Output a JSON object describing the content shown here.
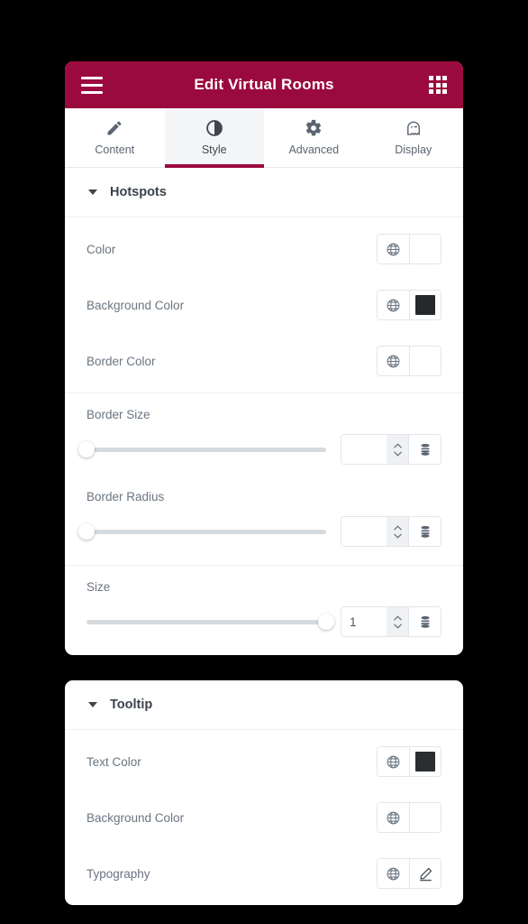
{
  "titlebar": {
    "menu_icon": "hamburger-icon",
    "title": "Edit Virtual Rooms",
    "apps_icon": "grid-apps-icon",
    "background_color": "#9B0A3E",
    "text_color": "#FFFFFF"
  },
  "tabs": [
    {
      "label": "Content",
      "icon": "pencil-icon",
      "active": false
    },
    {
      "label": "Style",
      "icon": "contrast-icon",
      "active": true
    },
    {
      "label": "Advanced",
      "icon": "gear-icon",
      "active": false
    },
    {
      "label": "Display",
      "icon": "ghost-icon",
      "active": false
    }
  ],
  "sections": [
    {
      "title": "Hotspots",
      "expanded": true,
      "groups": [
        {
          "controls": [
            {
              "type": "color",
              "label": "Color",
              "globe_icon": "globe-icon",
              "swatch": "none"
            },
            {
              "type": "color",
              "label": "Background Color",
              "globe_icon": "globe-icon",
              "swatch": "#26292C"
            },
            {
              "type": "color",
              "label": "Border Color",
              "globe_icon": "globe-icon",
              "swatch": "none"
            }
          ]
        },
        {
          "controls": [
            {
              "type": "slider",
              "label": "Border Size",
              "value": "",
              "placeholder": "",
              "handle_percent": 0,
              "spin_icon": "up-down-chevrons-icon",
              "units_icon": "units-stack-icon"
            },
            {
              "type": "slider",
              "label": "Border Radius",
              "value": "",
              "placeholder": "",
              "handle_percent": 0,
              "spin_icon": "up-down-chevrons-icon",
              "units_icon": "units-stack-icon"
            }
          ]
        },
        {
          "controls": [
            {
              "type": "slider",
              "label": "Size",
              "value": "1",
              "placeholder": "",
              "handle_percent": 100,
              "spin_icon": "up-down-chevrons-icon",
              "units_icon": "units-stack-icon"
            }
          ]
        }
      ]
    },
    {
      "title": "Tooltip",
      "expanded": true,
      "groups": [
        {
          "controls": [
            {
              "type": "color",
              "label": "Text Color",
              "globe_icon": "globe-icon",
              "swatch": "#2B2E31"
            },
            {
              "type": "color",
              "label": "Background Color",
              "globe_icon": "globe-icon",
              "swatch": "none"
            },
            {
              "type": "typography",
              "label": "Typography",
              "globe_icon": "globe-icon",
              "edit_icon": "pencil-edit-icon"
            }
          ]
        }
      ]
    }
  ],
  "theme": {
    "page_background": "#000000",
    "card_background": "#FFFFFF",
    "accent": "#9B0A3E",
    "label_color": "#6A7581",
    "divider": "#ECEFF1"
  }
}
